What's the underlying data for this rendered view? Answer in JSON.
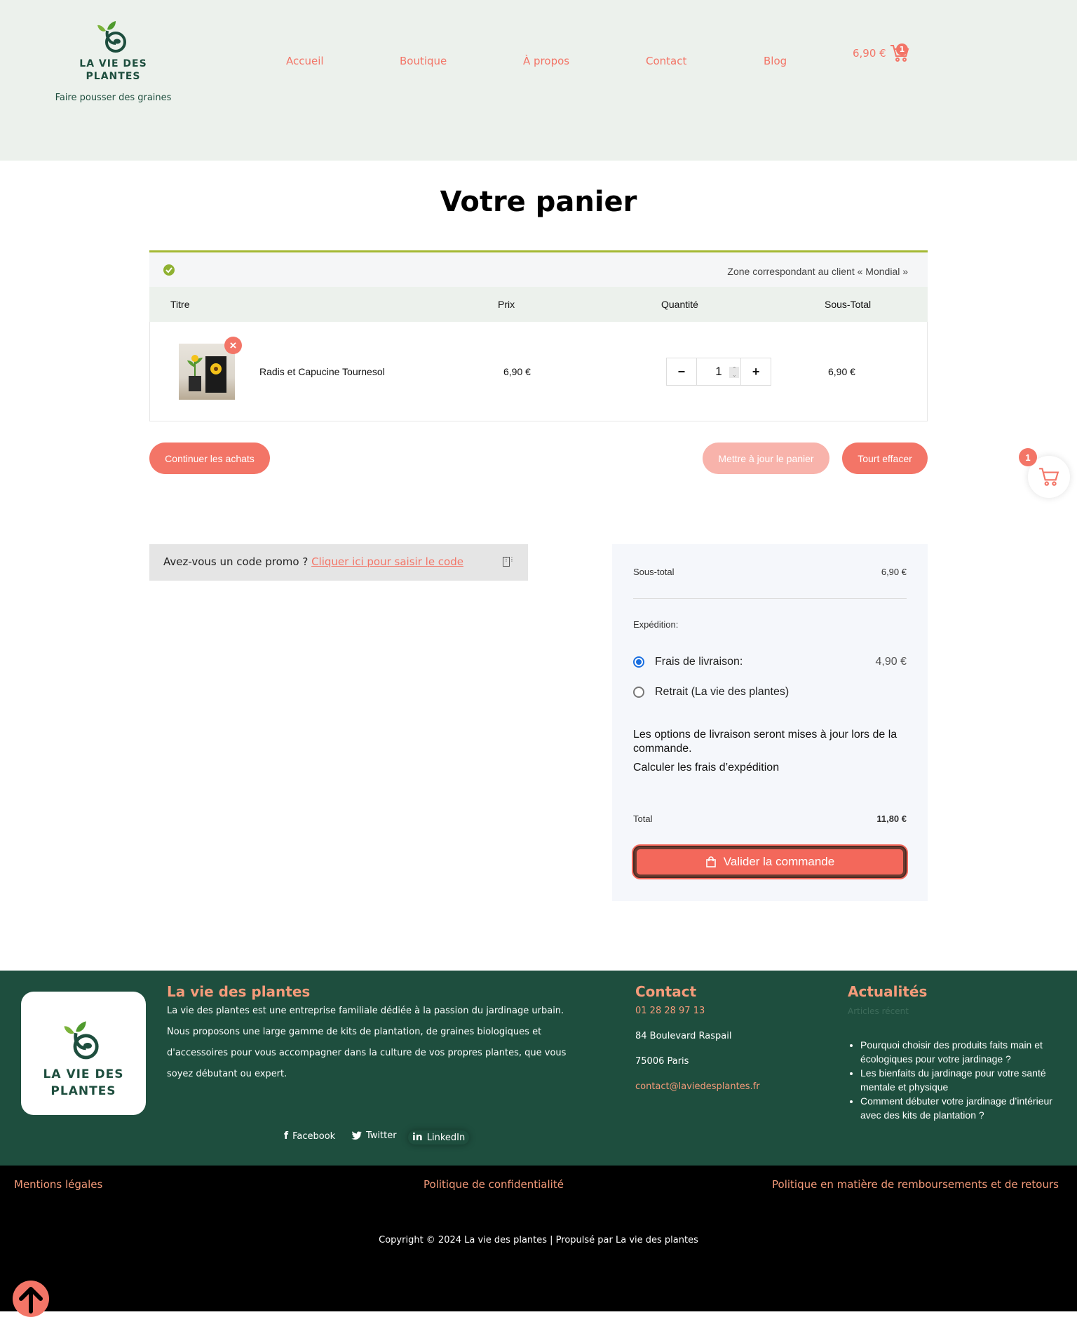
{
  "brand": {
    "name_line1": "LA VIE DES",
    "name_line2": "PLANTES",
    "tagline": "Faire pousser des graines",
    "colors": {
      "accent": "#f37567",
      "footer_bg": "#1e4e3e",
      "header_bg": "#ecf1ec",
      "heading_orange": "#f59b7a"
    }
  },
  "nav": {
    "items": [
      "Accueil",
      "Boutique",
      "À propos",
      "Contact",
      "Blog"
    ]
  },
  "header_cart": {
    "amount": "6,90 €",
    "count": "1",
    "icon": "cart-icon"
  },
  "page": {
    "title": "Votre panier"
  },
  "notice": {
    "text": "Zone correspondant au client « Mondial »",
    "icon": "check-circle-icon"
  },
  "cart_table": {
    "headers": [
      "Titre",
      "Prix",
      "Quantité",
      "Sous-Total"
    ],
    "rows": [
      {
        "product": "Radis et Capucine Tournesol",
        "price": "6,90 €",
        "quantity": "1",
        "subtotal": "6,90 €"
      }
    ],
    "qty_minus": "−",
    "qty_plus": "+",
    "remove_icon": "×"
  },
  "buttons": {
    "continue": "Continuer les achats",
    "update": "Mettre à jour le panier",
    "clear": "Tourt effacer"
  },
  "side_cart": {
    "count": "1",
    "icon": "cart-icon"
  },
  "promo": {
    "text": "Avez-vous un code promo ? ",
    "link": "Cliquer ici pour saisir le code"
  },
  "totals": {
    "subtotal_label": "Sous-total",
    "subtotal_value": "6,90 €",
    "shipping_label": "Expédition:",
    "option1_label": "Frais de livraison:",
    "option1_value": "4,90 €",
    "option2_label": "Retrait (La vie des plantes)",
    "info": "Les options de livraison seront mises à jour lors de la commande.",
    "calc": "Calculer les frais d’expédition",
    "total_label": "Total",
    "total_value": "11,80 €",
    "validate": "Valider la commande",
    "selected_option": "Frais de livraison:"
  },
  "footer": {
    "about_title": "La vie des plantes",
    "about_text": "La vie des plantes est une entreprise familiale dédiée à la passion du jardinage urbain. Nous proposons une large gamme de kits de plantation, de graines biologiques et d'accessoires pour vous accompagner dans la culture de vos propres plantes, que vous soyez débutant ou expert.",
    "contact_title": "Contact",
    "phone": "01 28 28 97 13",
    "address1": "84 Boulevard Raspail",
    "address2": "75006  Paris",
    "email": "contact@laviedesplantes.fr",
    "news_title": "Actualités",
    "news_subtitle": "Articles récent",
    "news": [
      "Pourquoi choisir des produits faits main et écologiques pour votre jardinage ?",
      "Les bienfaits du jardinage pour votre santé mentale et physique",
      "Comment débuter votre jardinage d’intérieur avec des kits de plantation ?"
    ],
    "social": {
      "facebook": "Facebook",
      "twitter": "Twitter",
      "linkedin": "LinkedIn"
    }
  },
  "bottom": {
    "legal": "Mentions légales",
    "privacy": "Politique de confidentialité",
    "refunds": "Politique en matière de remboursements et de retours",
    "copyright": "Copyright © 2024 La vie des plantes | Propulsé par La vie des plantes"
  }
}
